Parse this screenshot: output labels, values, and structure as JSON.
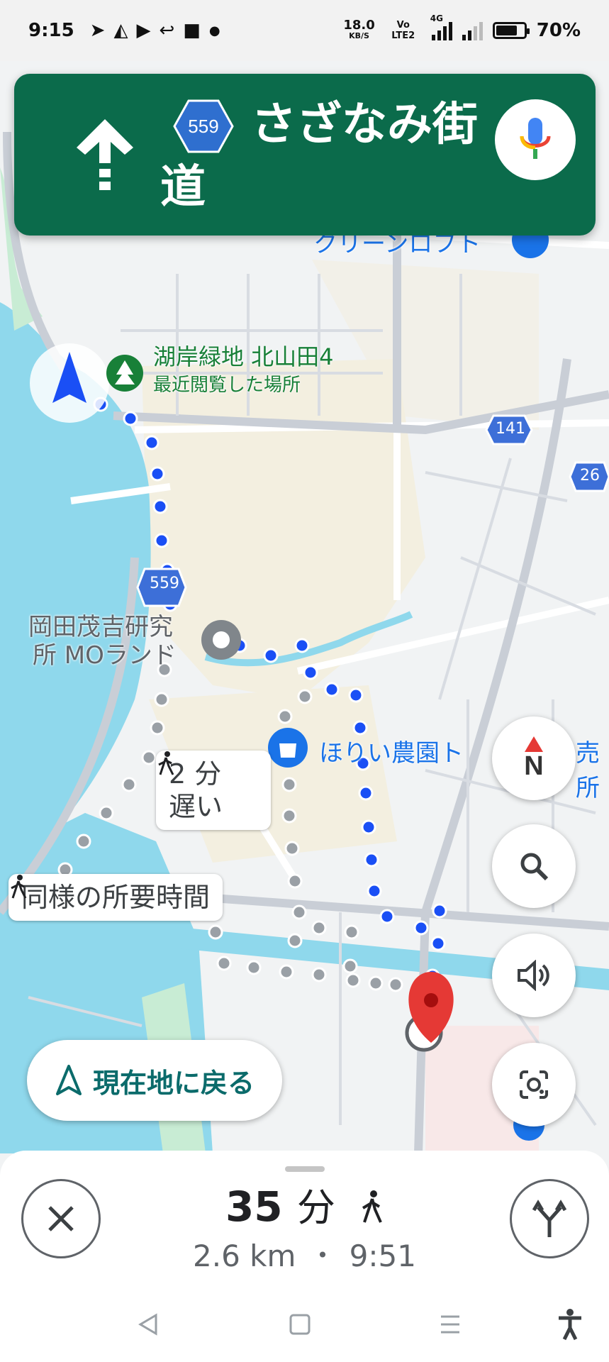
{
  "status_bar": {
    "time": "9:15",
    "net_speed": "18.0",
    "net_unit": "KB/S",
    "volte": "Vo LTE2",
    "network": "4G",
    "battery": "70%"
  },
  "navigation": {
    "route_number": "559",
    "street_name": "さざなみ街道",
    "next_maneuver": "straight"
  },
  "map": {
    "places": {
      "park_name": "湖岸緑地 北山田4",
      "park_sub": "最近閲覧した場所",
      "lab_name_line1": "岡田茂吉研究",
      "lab_name_line2": "所 MOランド",
      "farm_name": "ほりい農園ト",
      "farm_name_tail": "売所",
      "store_name": "クリーンロフト"
    },
    "road_badges": [
      "559",
      "141",
      "26"
    ],
    "callouts": {
      "alt_route_1": "2 分\n遅い",
      "alt_route_1_line1": "2 分",
      "alt_route_1_line2": "遅い",
      "alt_route_2": "同様の所要時間"
    }
  },
  "controls": {
    "compass_label": "N",
    "recenter_label": "現在地に戻る"
  },
  "trip": {
    "duration_value": "35",
    "duration_unit": "分",
    "distance": "2.6 km",
    "separator": "•",
    "arrival_time": "9:51"
  },
  "colors": {
    "nav_header": "#0b6b4b",
    "route_primary": "#1a4ff5",
    "route_alt": "#9aa0a6",
    "water": "#8fd8ec",
    "destination_pin": "#e53935"
  }
}
